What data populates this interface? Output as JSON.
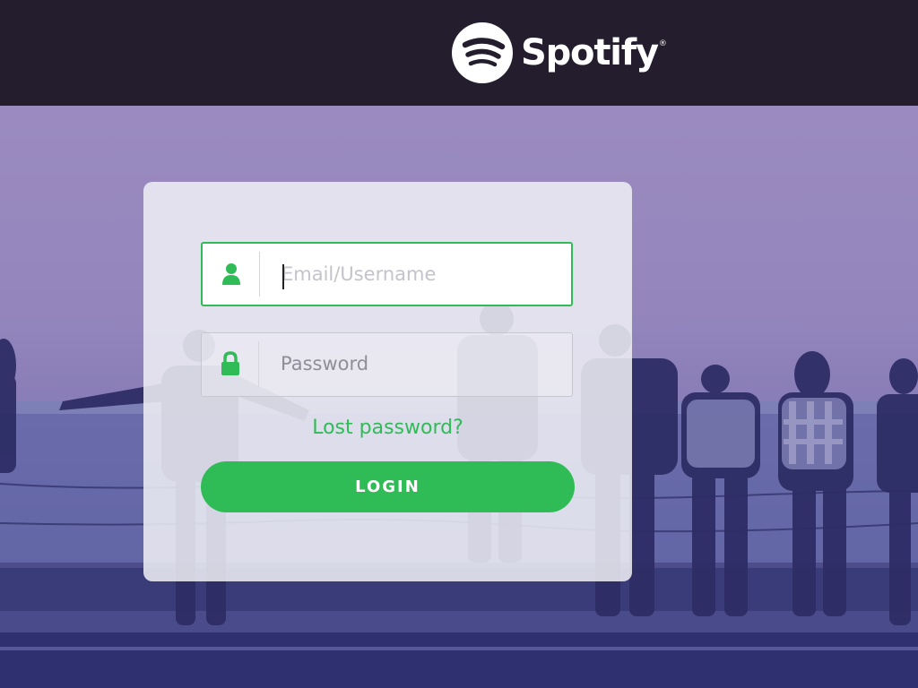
{
  "header": {
    "brand_name": "Spotify",
    "brand_mark": "®",
    "logo_icon": "spotify-logo-icon"
  },
  "login": {
    "username_placeholder": "Email/Username",
    "username_icon": "user-icon",
    "password_placeholder": "Password",
    "password_icon": "lock-icon",
    "lost_password": "Lost password?",
    "submit_label": "LOGIN"
  },
  "colors": {
    "accent": "#2fbc56",
    "header_bg": "#231d2d",
    "hero_tint": "#9486bd",
    "card_bg": "#f0f0f6"
  }
}
